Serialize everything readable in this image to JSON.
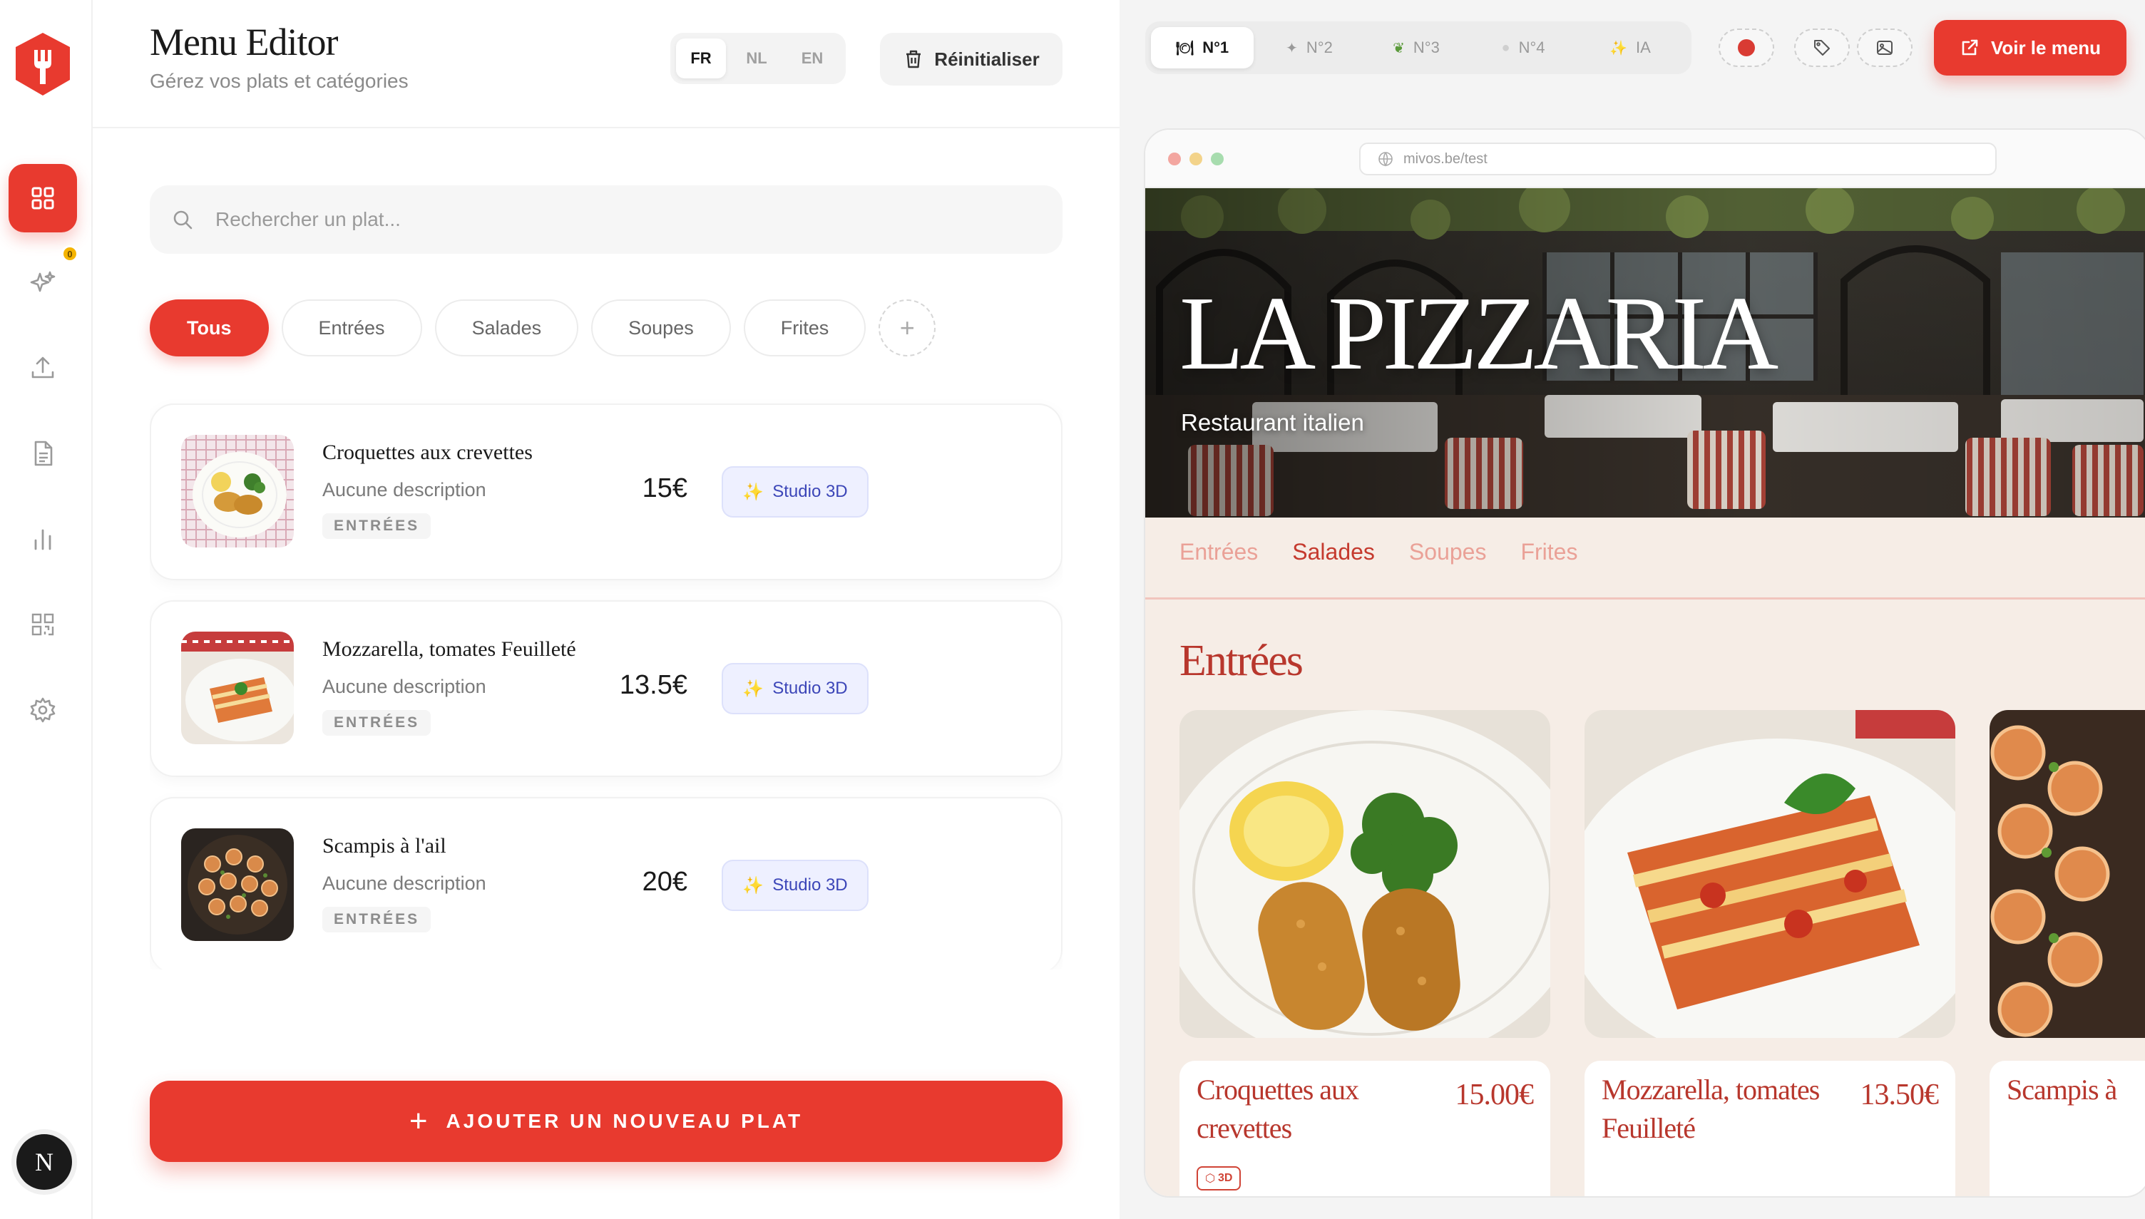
{
  "sidebar": {
    "nav": [
      {
        "name": "dashboard",
        "icon": "grid-icon"
      },
      {
        "name": "ai-studio",
        "icon": "sparkles-icon",
        "badge": "0"
      },
      {
        "name": "upload",
        "icon": "upload-icon"
      },
      {
        "name": "documents",
        "icon": "document-icon"
      },
      {
        "name": "analytics",
        "icon": "bar-chart-icon"
      },
      {
        "name": "qr-code",
        "icon": "qr-code-icon"
      },
      {
        "name": "settings",
        "icon": "gear-icon"
      }
    ],
    "avatar_initial": "N"
  },
  "editor": {
    "title": "Menu Editor",
    "subtitle": "Gérez vos plats et catégories",
    "languages": [
      "FR",
      "NL",
      "EN"
    ],
    "active_language": "FR",
    "reset_label": "Réinitialiser",
    "search_placeholder": "Rechercher un plat...",
    "categories": [
      "Tous",
      "Entrées",
      "Salades",
      "Soupes",
      "Frites"
    ],
    "active_category": "Tous",
    "dishes": [
      {
        "name": "Croquettes aux crevettes",
        "description": "Aucune description",
        "category": "ENTRÉES",
        "price": "15€",
        "studio_label": "Studio 3D"
      },
      {
        "name": "Mozzarella, tomates Feuilleté",
        "description": "Aucune description",
        "category": "ENTRÉES",
        "price": "13.5€",
        "studio_label": "Studio 3D"
      },
      {
        "name": "Scampis à l'ail",
        "description": "Aucune description",
        "category": "ENTRÉES",
        "price": "20€",
        "studio_label": "Studio 3D"
      }
    ],
    "add_label": "AJOUTER UN NOUVEAU PLAT"
  },
  "preview": {
    "themes": [
      {
        "label": "N°1",
        "icon": "utensils-icon"
      },
      {
        "label": "N°2",
        "icon": "star-icon"
      },
      {
        "label": "N°3",
        "icon": "leaf-icon"
      },
      {
        "label": "N°4",
        "icon": "circle-icon"
      },
      {
        "label": "IA",
        "icon": "sparkles-icon"
      }
    ],
    "active_theme": "N°1",
    "view_menu_label": "Voir le menu",
    "url": "mivos.be/test",
    "restaurant_name": "LA PIZZARIA",
    "restaurant_subtitle": "Restaurant italien",
    "menu_tabs": [
      "Entrées",
      "Salades",
      "Soupes",
      "Frites"
    ],
    "active_menu_tab": "Salades",
    "section_title": "Entrées",
    "cards": [
      {
        "name": "Croquettes aux crevettes",
        "price": "15.00€",
        "badge": "3D"
      },
      {
        "name": "Mozzarella, tomates Feuilleté",
        "price": "13.50€"
      },
      {
        "name": "Scampis à",
        "price": ""
      }
    ]
  },
  "colors": {
    "accent": "#e83a2f",
    "menu_red": "#b8372d",
    "menu_bg": "#f6ede6",
    "studio_blue": "#3c46b8"
  }
}
